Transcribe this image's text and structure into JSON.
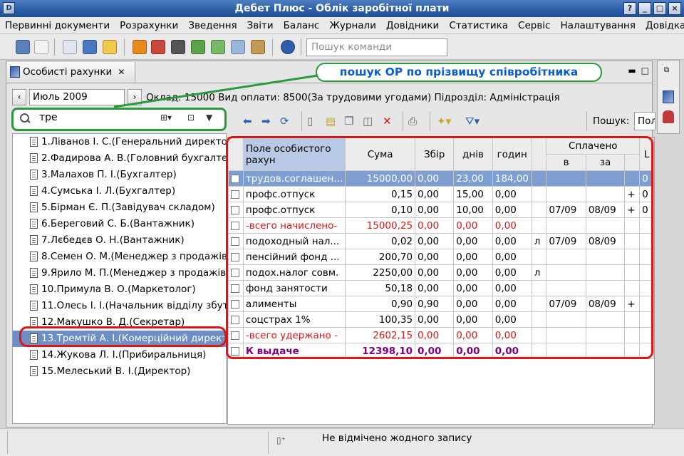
{
  "window": {
    "title": "Дебет Плюс - Облік заробітної плати"
  },
  "menu": [
    "Первинні документи",
    "Розрахунки",
    "Зведення",
    "Звіти",
    "Баланс",
    "Журнали",
    "Довідники",
    "Статистика",
    "Сервіс",
    "Налаштування",
    "Довідка"
  ],
  "toolbar": {
    "search_placeholder": "Пошук команди"
  },
  "tab": {
    "label": "Особисті рахунки"
  },
  "period": {
    "month": "Июль 2009",
    "info": "Оклад: 15000  Вид оплати: 8500(За трудовими угодами)  Підрозділ: Адміністрація"
  },
  "annotation": {
    "text": "пошук ОР по прізвищу співробітника"
  },
  "employee_search": {
    "query": "тре"
  },
  "employees": [
    "1.Ліванов І. С.(Генеральний директор)",
    "2.Фадирова А. В.(Головний бухгалтер)",
    "3.Малахов П. І.(Бухгалтер)",
    "4.Сумська І. Л.(Бухгалтер)",
    "5.Бірман Є. П.(Завідувач складом)",
    "6.Береговий С. Б.(Вантажник)",
    "7.Лєбедєв О. Н.(Вантажник)",
    "8.Семен О. М.(Менеджер з продажів)",
    "9.Ярило М. П.(Менеджер з продажів)",
    "10.Примула В. О.(Маркетолог)",
    "11.Олесь І. І.(Начальник відділу збуту)",
    "12.Макушко В. Д.(Секретар)",
    "13.Тремтій А. І.(Комерційний директор)",
    "14.Жукова Л. І.(Прибиральниця)",
    "15.Мелеський В. І.(Директор)"
  ],
  "selected_employee_index": 12,
  "grid_toolbar": {
    "search_label": "Пошук:",
    "search_value": "Пол"
  },
  "grid": {
    "headers": {
      "field": "Поле особистого рахун",
      "sum": "Сума",
      "sbir": "Збір",
      "days": "днів",
      "hours": "годин",
      "paid": "Сплачено",
      "paid_in": "в",
      "paid_for": "за",
      "last": "L"
    },
    "rows": [
      {
        "name": "трудов.соглашен...",
        "sum": "15000,00",
        "sbir": "0,00",
        "days": "23,00",
        "hours": "184,00",
        "flag": "",
        "in": "",
        "for": "",
        "plus": "",
        "last": "0",
        "style": "sel"
      },
      {
        "name": " профс.отпуск",
        "sum": "0,15",
        "sbir": "0,00",
        "days": "15,00",
        "hours": "0,00",
        "flag": "",
        "in": "",
        "for": "",
        "plus": "+",
        "last": "0",
        "style": ""
      },
      {
        "name": " профс.отпуск",
        "sum": "0,10",
        "sbir": "0,00",
        "days": "10,00",
        "hours": "0,00",
        "flag": "",
        "in": "07/09",
        "for": "08/09",
        "plus": "+",
        "last": "0",
        "style": ""
      },
      {
        "name": "-всего начислено-",
        "sum": "15000,25",
        "sbir": "0,00",
        "days": "0,00",
        "hours": "0,00",
        "flag": "",
        "in": "",
        "for": "",
        "plus": "",
        "last": "",
        "style": "red"
      },
      {
        "name": " подоходный нал...",
        "sum": "0,02",
        "sbir": "0,00",
        "days": "0,00",
        "hours": "0,00",
        "flag": "л",
        "in": "07/09",
        "for": "08/09",
        "plus": "",
        "last": "",
        "style": ""
      },
      {
        "name": "пенсійний фонд ...",
        "sum": "200,70",
        "sbir": "0,00",
        "days": "0,00",
        "hours": "0,00",
        "flag": "",
        "in": "",
        "for": "",
        "plus": "",
        "last": "",
        "style": ""
      },
      {
        "name": "подох.налог совм.",
        "sum": "2250,00",
        "sbir": "0,00",
        "days": "0,00",
        "hours": "0,00",
        "flag": "л",
        "in": "",
        "for": "",
        "plus": "",
        "last": "",
        "style": ""
      },
      {
        "name": " фонд занятости",
        "sum": "50,18",
        "sbir": "0,00",
        "days": "0,00",
        "hours": "0,00",
        "flag": "",
        "in": "",
        "for": "",
        "plus": "",
        "last": "",
        "style": ""
      },
      {
        "name": " алименты",
        "sum": "0,90",
        "sbir": "0,90",
        "days": "0,00",
        "hours": "0,00",
        "flag": "",
        "in": "07/09",
        "for": "08/09",
        "plus": "+",
        "last": "",
        "style": ""
      },
      {
        "name": "соцстрах 1%",
        "sum": "100,35",
        "sbir": "0,00",
        "days": "0,00",
        "hours": "0,00",
        "flag": "",
        "in": "",
        "for": "",
        "plus": "",
        "last": "",
        "style": ""
      },
      {
        "name": "-всего удержано -",
        "sum": "2602,15",
        "sbir": "0,00",
        "days": "0,00",
        "hours": "0,00",
        "flag": "",
        "in": "",
        "for": "",
        "plus": "",
        "last": "",
        "style": "red"
      },
      {
        "name": "  К выдаче",
        "sum": "12398,10",
        "sbir": "0,00",
        "days": "0,00",
        "hours": "0,00",
        "flag": "",
        "in": "",
        "for": "",
        "plus": "",
        "last": "",
        "style": "pur"
      }
    ]
  },
  "status": {
    "text": "Не відмічено жодного запису"
  },
  "colors": {
    "highlight_red": "#e01515",
    "annotation_green": "#2c9a3c",
    "annotation_text": "#0a5ecf",
    "selection": "#6e8fc4",
    "total_purple": "#800080"
  }
}
